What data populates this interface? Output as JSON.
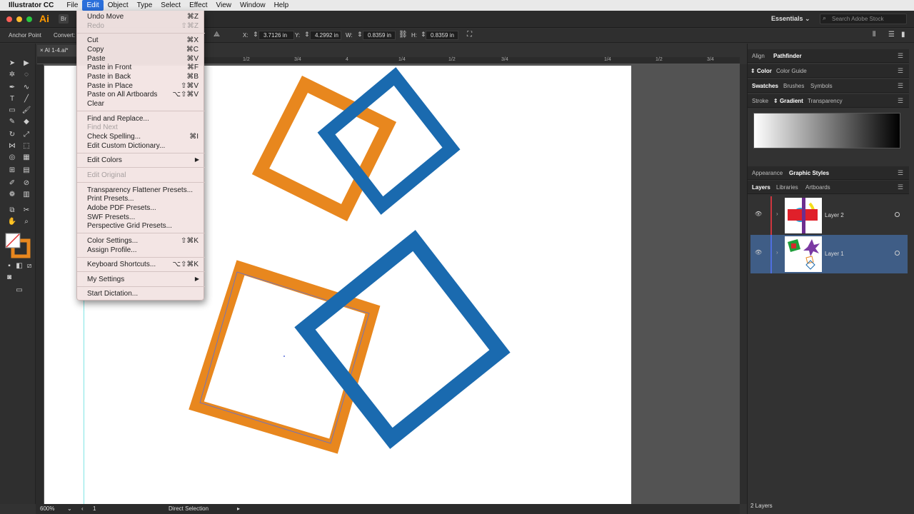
{
  "menubar": {
    "app_name": "Illustrator CC",
    "items": [
      "File",
      "Edit",
      "Object",
      "Type",
      "Select",
      "Effect",
      "View",
      "Window",
      "Help"
    ],
    "active": "Edit"
  },
  "appbar": {
    "logo": "Ai",
    "bridge": "Br",
    "workspace": "Essentials",
    "search_placeholder": "Search Adobe Stock"
  },
  "controlbar": {
    "anchor_label": "Anchor Point",
    "convert_label": "Convert:",
    "x_label": "X:",
    "x_value": "3.7126 in",
    "y_label": "Y:",
    "y_value": "4.2992 in",
    "w_label": "W:",
    "w_value": "0.8359 in",
    "h_label": "H:",
    "h_value": "0.8359 in"
  },
  "document": {
    "tab_label": "AI 1-4.ai*",
    "ruler_labels": [
      "1/2",
      "3/4",
      "4",
      "1/4",
      "1/2",
      "3/4",
      "1/4",
      "1/2",
      "3/4"
    ]
  },
  "statusbar": {
    "zoom": "600%",
    "artboard_number": "1",
    "tool_name": "Direct Selection"
  },
  "edit_menu": {
    "items": [
      {
        "label": "Undo Move",
        "shortcut": "⌘Z",
        "disabled": false
      },
      {
        "label": "Redo",
        "shortcut": "⇧⌘Z",
        "disabled": true
      },
      {
        "label": "Cut",
        "shortcut": "⌘X",
        "disabled": false
      },
      {
        "label": "Copy",
        "shortcut": "⌘C",
        "disabled": false
      },
      {
        "label": "Paste",
        "shortcut": "⌘V",
        "disabled": false
      },
      {
        "label": "Paste in Front",
        "shortcut": "⌘F",
        "disabled": false
      },
      {
        "label": "Paste in Back",
        "shortcut": "⌘B",
        "disabled": false
      },
      {
        "label": "Paste in Place",
        "shortcut": "⇧⌘V",
        "disabled": false
      },
      {
        "label": "Paste on All Artboards",
        "shortcut": "⌥⇧⌘V",
        "disabled": false
      },
      {
        "label": "Clear",
        "shortcut": "",
        "disabled": false
      },
      {
        "label": "Find and Replace...",
        "shortcut": "",
        "disabled": false
      },
      {
        "label": "Find Next",
        "shortcut": "",
        "disabled": true
      },
      {
        "label": "Check Spelling...",
        "shortcut": "⌘I",
        "disabled": false
      },
      {
        "label": "Edit Custom Dictionary...",
        "shortcut": "",
        "disabled": false
      },
      {
        "label": "Edit Colors",
        "shortcut": "",
        "disabled": false,
        "submenu": true
      },
      {
        "label": "Edit Original",
        "shortcut": "",
        "disabled": true
      },
      {
        "label": "Transparency Flattener Presets...",
        "shortcut": "",
        "disabled": false
      },
      {
        "label": "Print Presets...",
        "shortcut": "",
        "disabled": false
      },
      {
        "label": "Adobe PDF Presets...",
        "shortcut": "",
        "disabled": false
      },
      {
        "label": "SWF Presets...",
        "shortcut": "",
        "disabled": false
      },
      {
        "label": "Perspective Grid Presets...",
        "shortcut": "",
        "disabled": false
      },
      {
        "label": "Color Settings...",
        "shortcut": "⇧⌘K",
        "disabled": false
      },
      {
        "label": "Assign Profile...",
        "shortcut": "",
        "disabled": false
      },
      {
        "label": "Keyboard Shortcuts...",
        "shortcut": "⌥⇧⌘K",
        "disabled": false
      },
      {
        "label": "My Settings",
        "shortcut": "",
        "disabled": false,
        "submenu": true
      },
      {
        "label": "Start Dictation...",
        "shortcut": "",
        "disabled": false
      }
    ]
  },
  "panels": {
    "group1": [
      "Align",
      "Pathfinder"
    ],
    "group2": [
      "Color",
      "Color Guide"
    ],
    "group3": [
      "Swatches",
      "Brushes",
      "Symbols"
    ],
    "group4": [
      "Stroke",
      "Gradient",
      "Transparency"
    ],
    "group5": [
      "Appearance",
      "Graphic Styles"
    ],
    "group6": [
      "Layers",
      "Libraries",
      "Artboards"
    ],
    "layers": [
      {
        "name": "Layer 2",
        "color": "#d0363f"
      },
      {
        "name": "Layer 1",
        "color": "#4f6fe0"
      }
    ],
    "layer_count": "2 Layers"
  },
  "colors": {
    "orange": "#e8871e",
    "blue": "#1a6aaf",
    "menu_highlight": "#2a6fdb"
  }
}
